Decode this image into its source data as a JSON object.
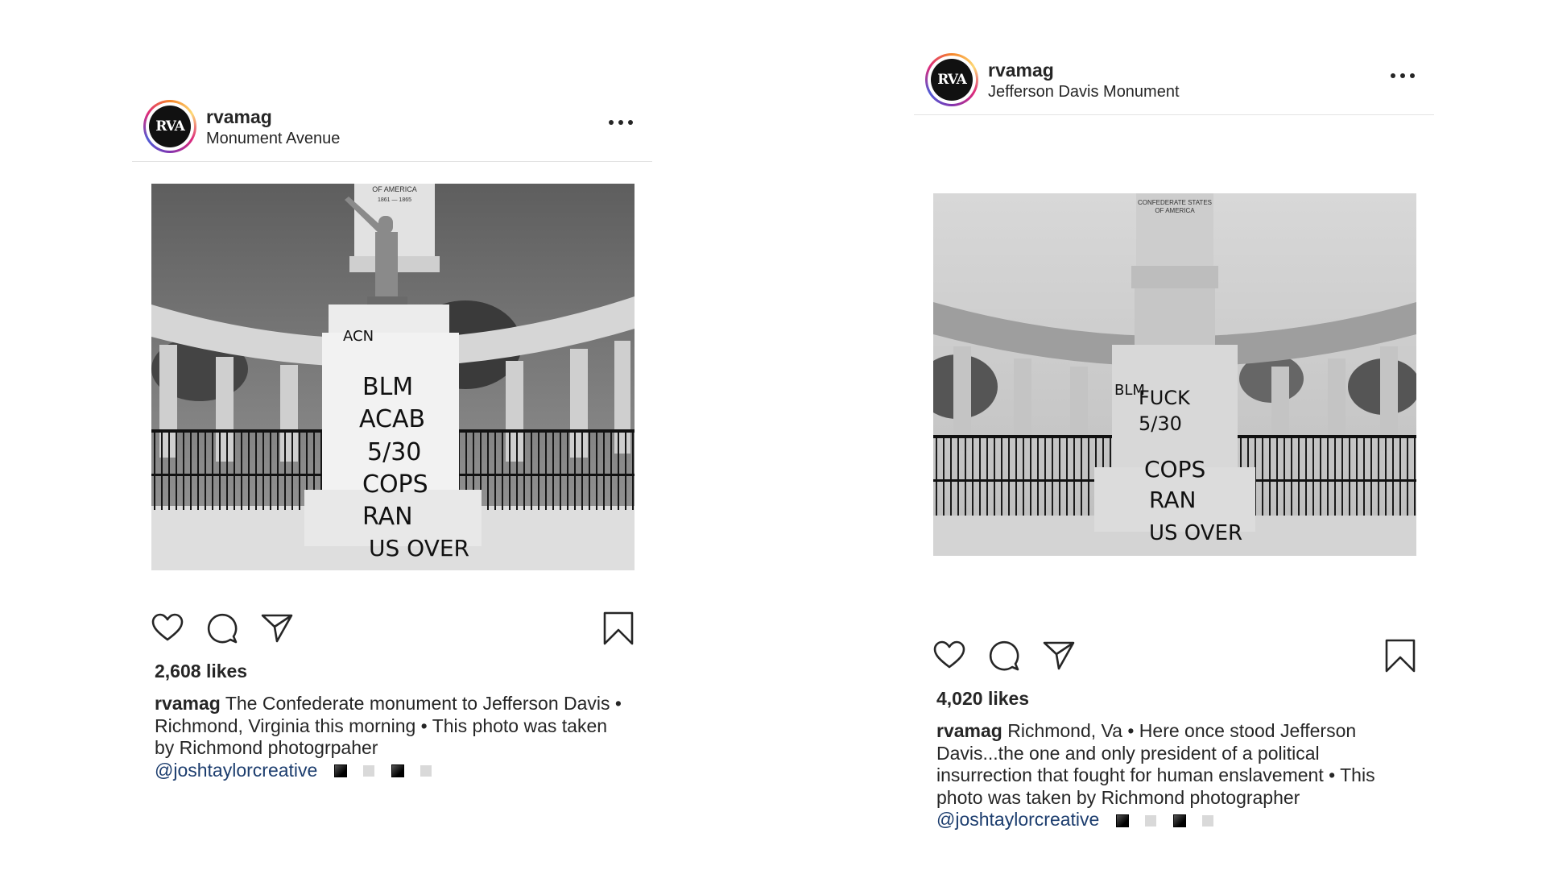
{
  "posts": [
    {
      "username": "rvamag",
      "avatar_text": "RVA",
      "location": "Monument Avenue",
      "photo": {
        "description": "Black and white photo of Jefferson Davis statue with graffiti",
        "graffiti": [
          "BLM",
          "ACAB",
          "5/30",
          "COPS",
          "RAN",
          "US OVER"
        ],
        "inscription": "OF AMERICA"
      },
      "likes": "2,608 likes",
      "caption_user": "rvamag",
      "caption_text": "The Confederate monument to Jefferson Davis • Richmond, Virginia this morning • This photo was taken by Richmond photogrpaher",
      "mention": "@joshtaylorcreative",
      "squares": [
        "dark",
        "light",
        "dark",
        "light"
      ],
      "icons": [
        "heart-icon",
        "comment-icon",
        "share-icon",
        "bookmark-icon",
        "more-icon"
      ]
    },
    {
      "username": "rvamag",
      "avatar_text": "RVA",
      "location": "Jefferson Davis Monument",
      "photo": {
        "description": "Black and white photo of column base without statue, with graffiti",
        "graffiti": [
          "BLM",
          "FUCK",
          "5/30",
          "COPS",
          "RAN",
          "US OVER"
        ],
        "inscription": "CONFEDERATE STATES OF AMERICA"
      },
      "likes": "4,020 likes",
      "caption_user": "rvamag",
      "caption_text": "Richmond, Va • Here once stood Jefferson Davis...the one and only president of a political insurrection that fought for human enslavement • This photo was taken by Richmond photographer",
      "mention": "@joshtaylorcreative",
      "squares": [
        "dark",
        "light",
        "dark",
        "light"
      ],
      "icons": [
        "heart-icon",
        "comment-icon",
        "share-icon",
        "bookmark-icon",
        "more-icon"
      ]
    }
  ]
}
